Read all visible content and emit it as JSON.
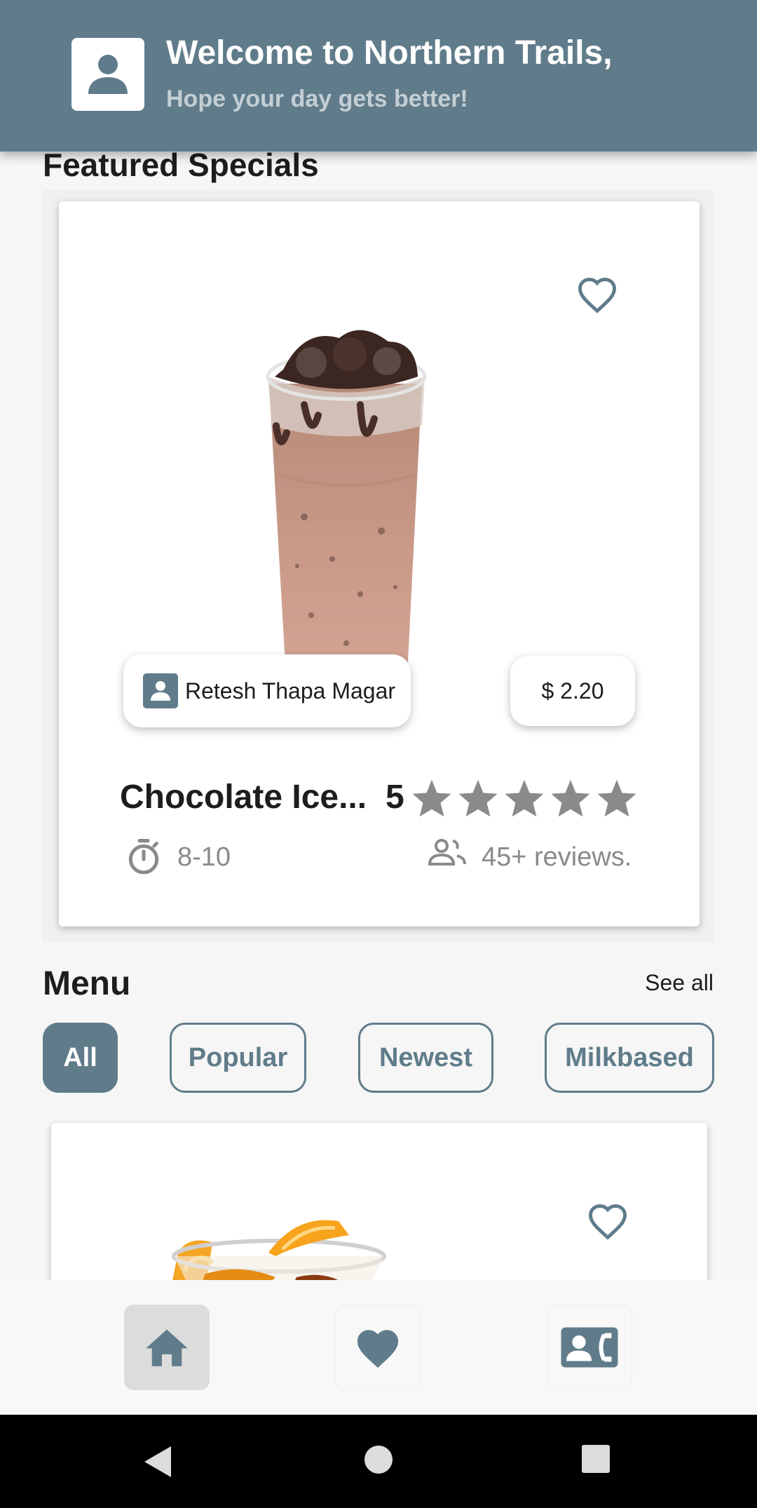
{
  "header": {
    "title": "Welcome to Northern Trails,",
    "subtitle": "Hope your day gets better!",
    "avatar_icon": "account-box-icon"
  },
  "featured": {
    "title": "Featured Specials",
    "item": {
      "name": "Chocolate Ice...",
      "author": "Retesh Thapa Magar",
      "price": "$ 2.20",
      "rating": "5",
      "stars": 5,
      "time": "8-10",
      "reviews": "45+ reviews.",
      "favorite_icon": "heart-outline-icon"
    }
  },
  "menu": {
    "title": "Menu",
    "see_all": "See all",
    "filters": [
      "All",
      "Popular",
      "Newest",
      "Milkbased"
    ],
    "active_filter": "All"
  },
  "bottom_nav": {
    "items": [
      "home-icon",
      "heart-icon",
      "contact-phone-icon"
    ],
    "active": "home-icon"
  },
  "system_bar": [
    "back-icon",
    "home-circle-icon",
    "recents-icon"
  ],
  "colors": {
    "primary": "#607c8b",
    "background": "#f6f6f6",
    "star": "#8a8a8a"
  }
}
